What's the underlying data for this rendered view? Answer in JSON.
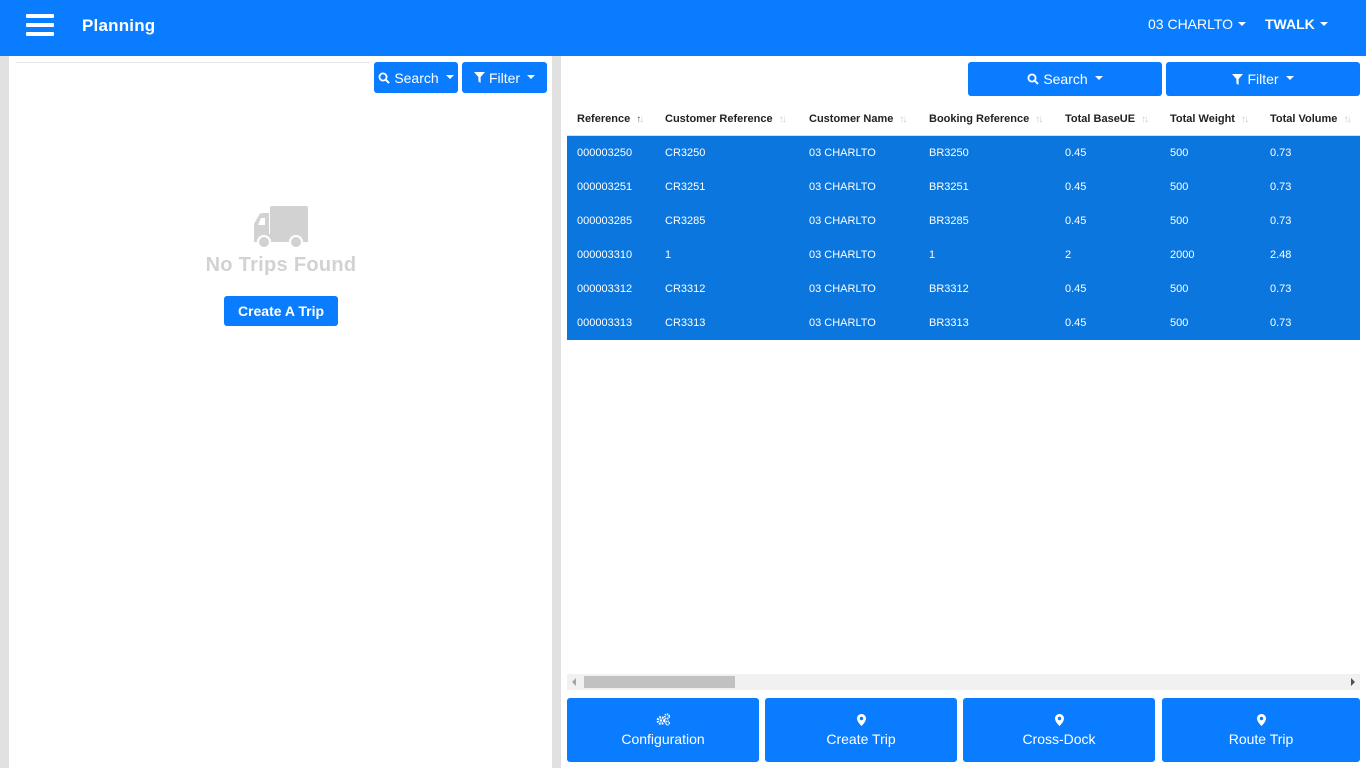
{
  "app": {
    "title": "Planning"
  },
  "topbar": {
    "location": "03 CHARLTO",
    "user": "TWALK"
  },
  "left": {
    "search_label": "Search",
    "filter_label": "Filter",
    "empty_text": "No Trips Found",
    "create_button": "Create A Trip"
  },
  "right": {
    "search_label": "Search",
    "filter_label": "Filter",
    "columns": [
      "Reference",
      "Customer Reference",
      "Customer Name",
      "Booking Reference",
      "Total BaseUE",
      "Total Weight",
      "Total Volume"
    ],
    "rows": [
      [
        "000003250",
        "CR3250",
        "03 CHARLTO",
        "BR3250",
        "0.45",
        "500",
        "0.73"
      ],
      [
        "000003251",
        "CR3251",
        "03 CHARLTO",
        "BR3251",
        "0.45",
        "500",
        "0.73"
      ],
      [
        "000003285",
        "CR3285",
        "03 CHARLTO",
        "BR3285",
        "0.45",
        "500",
        "0.73"
      ],
      [
        "000003310",
        "1",
        "03 CHARLTO",
        "1",
        "2",
        "2000",
        "2.48"
      ],
      [
        "000003312",
        "CR3312",
        "03 CHARLTO",
        "BR3312",
        "0.45",
        "500",
        "0.73"
      ],
      [
        "000003313",
        "CR3313",
        "03 CHARLTO",
        "BR3313",
        "0.45",
        "500",
        "0.73"
      ]
    ]
  },
  "actions": [
    {
      "label": "Configuration",
      "icon": "cogs-icon"
    },
    {
      "label": "Create Trip",
      "icon": "map-marker-icon"
    },
    {
      "label": "Cross-Dock",
      "icon": "map-marker-icon"
    },
    {
      "label": "Route Trip",
      "icon": "map-marker-icon"
    }
  ],
  "colors": {
    "primary": "#0a7cff",
    "row_selected": "#0b76dd",
    "empty_text": "#d2d2d2"
  }
}
